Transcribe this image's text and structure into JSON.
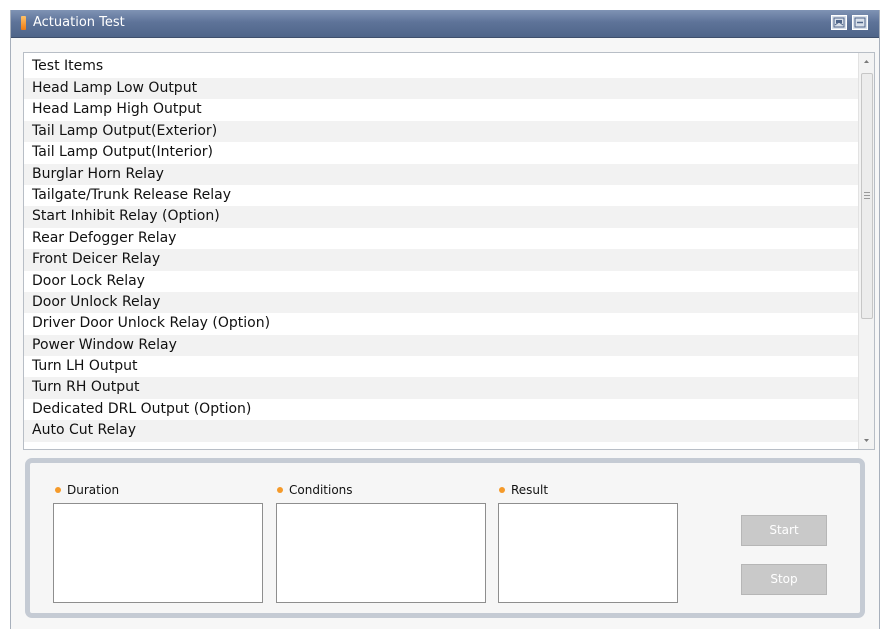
{
  "window": {
    "title": "Actuation Test"
  },
  "list": {
    "header": "Test Items",
    "items": [
      "Head Lamp Low Output",
      "Head Lamp High Output",
      "Tail Lamp Output(Exterior)",
      "Tail Lamp Output(Interior)",
      "Burglar Horn Relay",
      "Tailgate/Trunk Release Relay",
      "Start Inhibit Relay (Option)",
      "Rear Defogger Relay",
      "Front Deicer Relay",
      "Door Lock Relay",
      "Door Unlock Relay",
      "Driver Door Unlock Relay (Option)",
      "Power Window Relay",
      "Turn LH Output",
      "Turn RH Output",
      "Dedicated DRL Output (Option)",
      "Auto Cut Relay"
    ]
  },
  "panel": {
    "duration_label": "Duration",
    "conditions_label": "Conditions",
    "result_label": "Result",
    "duration_value": "",
    "conditions_value": "",
    "result_value": "",
    "start_label": "Start",
    "stop_label": "Stop"
  },
  "icons": {
    "title_marker": "title-marker-icon",
    "restore": "restore-window-icon",
    "minimize": "minimize-window-icon",
    "scroll_up": "scroll-up-arrow-icon",
    "scroll_down": "scroll-down-arrow-icon",
    "bullet": "orange-dot-icon"
  },
  "colors": {
    "titlebar": "#5e7399",
    "accent": "#f59a2a",
    "disabled_button": "#c9c9c9",
    "panel_border": "#c5cbd4"
  }
}
